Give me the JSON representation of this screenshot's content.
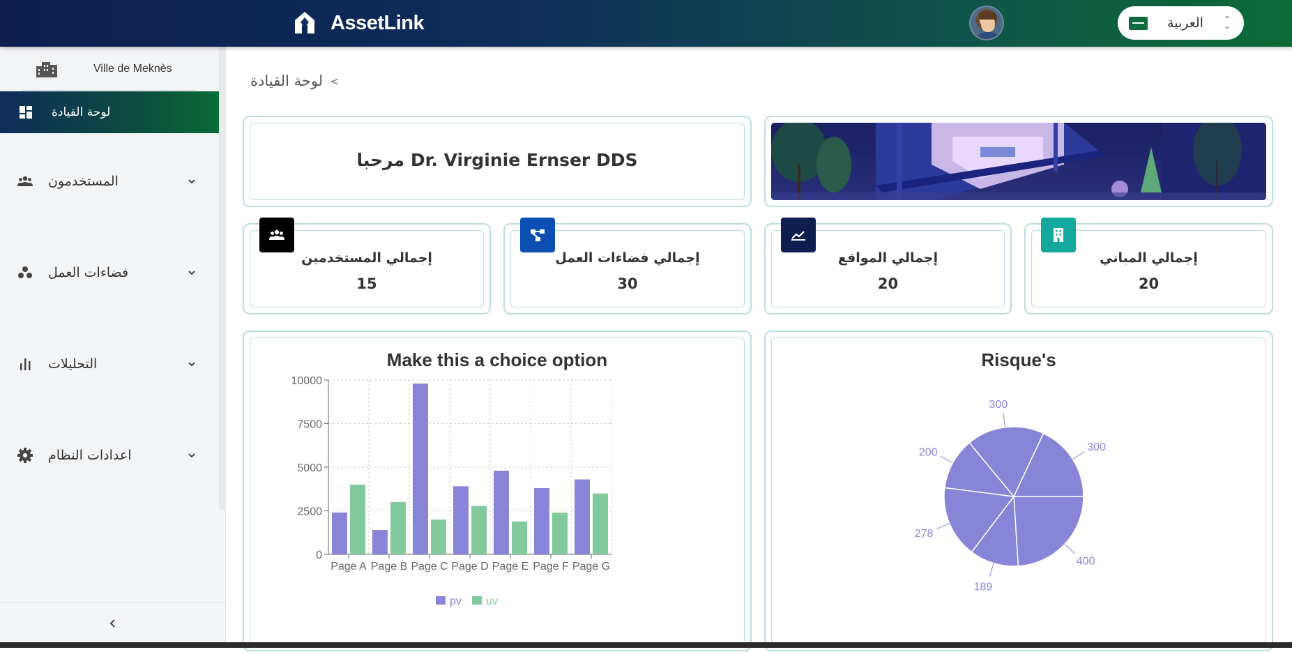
{
  "app": {
    "name": "AssetLink",
    "language_label": "العربية",
    "colors": {
      "header_start": "#0d1e4f",
      "header_end": "#0a6b38",
      "pv": "#8884d8",
      "uv": "#82ca9d",
      "card_border": "#b9dde1"
    }
  },
  "sidebar": {
    "organization": "Ville de Meknès",
    "active_item": {
      "label": "لوحة القيادة",
      "icon": "dashboard-icon"
    },
    "items": [
      {
        "label": "المستخدمون",
        "icon": "users-icon"
      },
      {
        "label": "فضاءات العمل",
        "icon": "workspaces-icon"
      },
      {
        "label": "التحليلات",
        "icon": "analytics-icon"
      },
      {
        "label": "اعدادات النظام",
        "icon": "settings-icon"
      }
    ]
  },
  "breadcrumb": {
    "current": "لوحة القيادة",
    "separator": "<"
  },
  "welcome": {
    "text": "مرحبا Dr. Virginie Ernser DDS"
  },
  "stats": [
    {
      "title": "إجمالي المستخدمين",
      "value": "15",
      "icon": "users-icon",
      "color": "#000000"
    },
    {
      "title": "إجمالي فضاءات العمل",
      "value": "30",
      "icon": "workspace-tree-icon",
      "color": "#0b4fb3"
    },
    {
      "title": "إجمالي المواقع",
      "value": "20",
      "icon": "sites-chart-icon",
      "color": "#0d1e4f"
    },
    {
      "title": "إجمالي المباني",
      "value": "20",
      "icon": "building-icon",
      "color": "#13a89e"
    }
  ],
  "chart_data": [
    {
      "type": "bar",
      "title": "Make this a choice option",
      "categories": [
        "Page A",
        "Page B",
        "Page C",
        "Page D",
        "Page E",
        "Page F",
        "Page G"
      ],
      "series": [
        {
          "name": "pv",
          "values": [
            2400,
            1398,
            9800,
            3908,
            4800,
            3800,
            4300
          ]
        },
        {
          "name": "uv",
          "values": [
            4000,
            3000,
            2000,
            2780,
            1890,
            2390,
            3490
          ]
        }
      ],
      "yticks": [
        "0",
        "2500",
        "5000",
        "7500",
        "10000"
      ],
      "ylim": [
        0,
        10000
      ],
      "grid": true,
      "legend": "bottom"
    },
    {
      "type": "pie",
      "title": "Risque's",
      "values": [
        400,
        189,
        278,
        200,
        300,
        300
      ],
      "labels": [
        "400",
        "189",
        "278",
        "200",
        "300",
        "300"
      ],
      "legend": "none"
    }
  ]
}
